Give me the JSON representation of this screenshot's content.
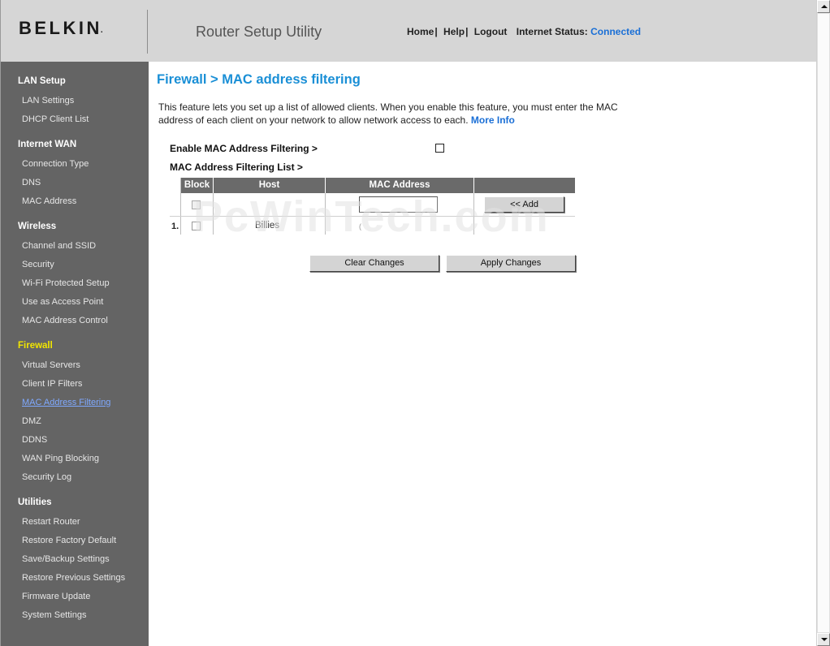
{
  "header": {
    "logo": "BELKIN",
    "logo_mark": ".",
    "utility_title": "Router Setup Utility",
    "nav": {
      "home": "Home",
      "help": "Help",
      "logout": "Logout",
      "sep": "|"
    },
    "status_label": "Internet Status:",
    "status_value": "Connected"
  },
  "sidebar": {
    "lan_setup": {
      "title": "LAN Setup",
      "items": [
        "LAN Settings",
        "DHCP Client List"
      ]
    },
    "internet_wan": {
      "title": "Internet WAN",
      "items": [
        "Connection Type",
        "DNS",
        "MAC Address"
      ]
    },
    "wireless": {
      "title": "Wireless",
      "items": [
        "Channel and SSID",
        "Security",
        "Wi-Fi Protected Setup",
        "Use as Access Point",
        "MAC Address Control"
      ]
    },
    "firewall": {
      "title": "Firewall",
      "items": [
        "Virtual Servers",
        "Client IP Filters",
        "MAC Address Filtering",
        "DMZ",
        "DDNS",
        "WAN Ping Blocking",
        "Security Log"
      ]
    },
    "utilities": {
      "title": "Utilities",
      "items": [
        "Restart Router",
        "Restore Factory Default",
        "Save/Backup Settings",
        "Restore Previous Settings",
        "Firmware Update",
        "System Settings"
      ]
    }
  },
  "main": {
    "title": "Firewall > MAC address filtering",
    "intro": "This feature lets you set up a list of allowed clients. When you enable this feature, you must enter the MAC address of each client on your network to allow network access to each.",
    "more_info": "More Info",
    "enable_label": "Enable MAC Address Filtering >",
    "enable_checked": false,
    "list_label": "MAC Address Filtering List >",
    "table": {
      "headers": {
        "block": "Block",
        "host": "Host",
        "mac": "MAC Address"
      },
      "add_button": "<< Add",
      "mac_input_value": "",
      "rows": [
        {
          "num": "1.",
          "host": "Billies",
          "mac": "("
        }
      ]
    },
    "clear_button": "Clear Changes",
    "apply_button": "Apply Changes"
  },
  "watermark": "PcWinTech.com"
}
